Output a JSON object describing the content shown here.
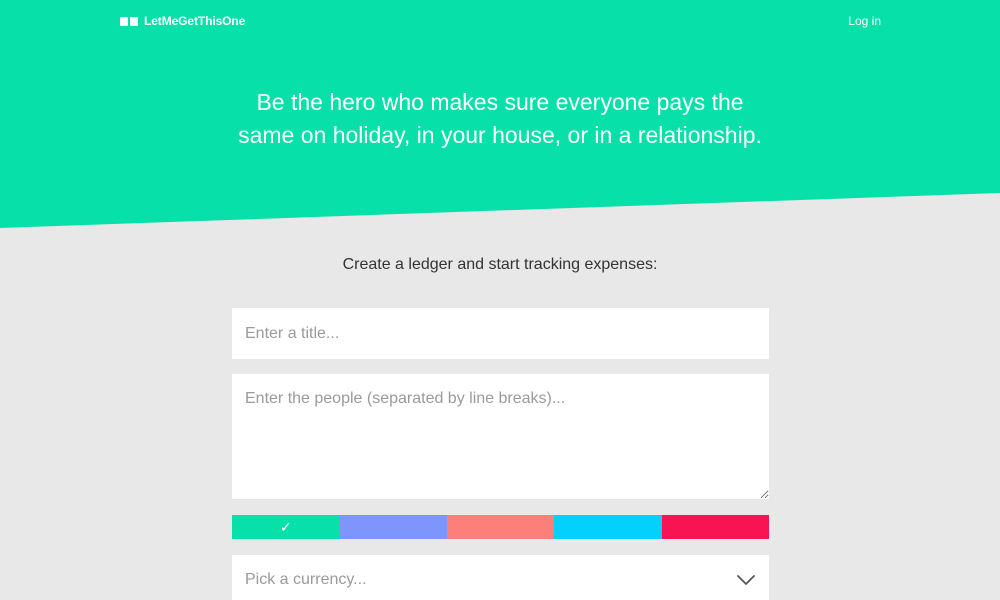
{
  "nav": {
    "logo_text": "LetMeGetThisOne",
    "login_label": "Log in"
  },
  "hero": {
    "headline_line1": "Be the hero who makes sure everyone pays the",
    "headline_line2": "same on holiday, in your house, or in a relationship."
  },
  "form": {
    "subtitle": "Create a ledger and start tracking expenses:",
    "title_placeholder": "Enter a title...",
    "people_placeholder": "Enter the people (separated by line breaks)...",
    "colors": [
      {
        "hex": "#08e0aa",
        "selected": true,
        "mark": "✓"
      },
      {
        "hex": "#7e96fb",
        "selected": false,
        "mark": ""
      },
      {
        "hex": "#fd7f79",
        "selected": false,
        "mark": ""
      },
      {
        "hex": "#02d0fd",
        "selected": false,
        "mark": ""
      },
      {
        "hex": "#fa1354",
        "selected": false,
        "mark": ""
      }
    ],
    "currency_placeholder": "Pick a currency...",
    "currency_icon": "chevron-down-icon"
  },
  "theme": {
    "accent": "#08e0aa",
    "background": "#e8e8e8"
  }
}
